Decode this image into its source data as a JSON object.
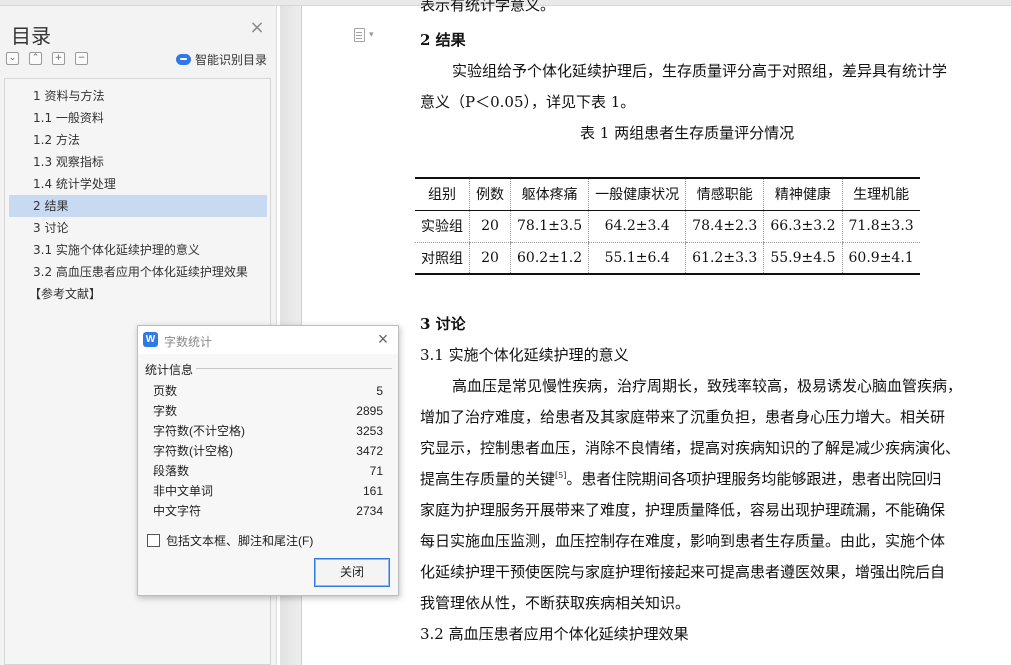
{
  "nav": {
    "title": "目录",
    "smart_toc": "智能识别目录",
    "items": [
      {
        "label": "1 资料与方法",
        "active": false
      },
      {
        "label": "1.1 一般资料",
        "active": false
      },
      {
        "label": "1.2 方法",
        "active": false
      },
      {
        "label": "1.3 观察指标",
        "active": false
      },
      {
        "label": "1.4 统计学处理",
        "active": false
      },
      {
        "label": "2 结果",
        "active": true
      },
      {
        "label": "3 讨论",
        "active": false
      },
      {
        "label": "3.1 实施个体化延续护理的意义",
        "active": false
      },
      {
        "label": "3.2 高血压患者应用个体化延续护理效果",
        "active": false
      },
      {
        "label": "【参考文献】",
        "active": false
      }
    ]
  },
  "doc": {
    "top_partial": "表示有统计学意义。",
    "h2": "2 结果",
    "p1_l1": "实验组给予个体化延续护理后，生存质量评分高于对照组，差异具有统计学",
    "p1_l2": "意义（P＜0.05），详见下表 1。",
    "table_caption": "表 1   两组患者生存质量评分情况",
    "table": {
      "headers": [
        "组别",
        "例数",
        "躯体疼痛",
        "一般健康状况",
        "情感职能",
        "精神健康",
        "生理机能"
      ],
      "rows": [
        [
          "实验组",
          "20",
          "78.1±3.5",
          "64.2±3.4",
          "78.4±2.3",
          "66.3±3.2",
          "71.8±3.3"
        ],
        [
          "对照组",
          "20",
          "60.2±1.2",
          "55.1±6.4",
          "61.2±3.3",
          "55.9±4.5",
          "60.9±4.1"
        ]
      ]
    },
    "h3": "3 讨论",
    "h31": "3.1 实施个体化延续护理的意义",
    "p2": [
      "高血压是常见慢性疾病，治疗周期长，致残率较高，极易诱发心脑血管疾病，",
      "增加了治疗难度，给患者及其家庭带来了沉重负担，患者身心压力增大。相关研",
      "究显示，控制患者血压，消除不良情绪，提高对疾病知识的了解是减少疾病演化、",
      "提高生存质量的关键",
      "。患者住院期间各项护理服务均能够跟进，患者出院回归",
      "家庭为护理服务开展带来了难度，护理质量降低，容易出现护理疏漏，不能确保",
      "每日实施血压监测，血压控制存在难度，影响到患者生存质量。由此，实施个体",
      "化延续护理干预使医院与家庭护理衔接起来可提高患者遵医效果，增强出院后自",
      "我管理依从性，不断获取疾病相关知识。"
    ],
    "cite": "[5]",
    "h32": "3.2 高血压患者应用个体化延续护理效果"
  },
  "dialog": {
    "title": "字数统计",
    "section": "统计信息",
    "stats": [
      {
        "label": "页数",
        "value": "5"
      },
      {
        "label": "字数",
        "value": "2895"
      },
      {
        "label": "字符数(不计空格)",
        "value": "3253"
      },
      {
        "label": "字符数(计空格)",
        "value": "3472"
      },
      {
        "label": "段落数",
        "value": "71"
      },
      {
        "label": "非中文单词",
        "value": "161"
      },
      {
        "label": "中文字符",
        "value": "2734"
      }
    ],
    "checkbox_label": "包括文本框、脚注和尾注(F)",
    "close_label": "关闭"
  }
}
